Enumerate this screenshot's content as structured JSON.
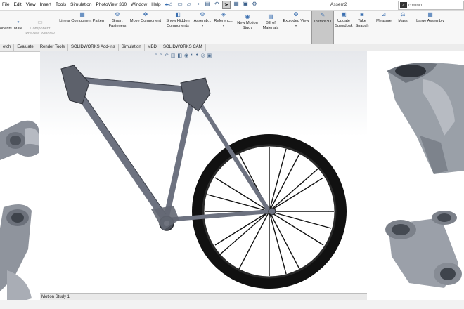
{
  "menu": [
    "File",
    "Edit",
    "View",
    "Insert",
    "Tools",
    "Simulation",
    "PhotoView 360",
    "Window",
    "Help"
  ],
  "document_title": "Assem2",
  "search": {
    "value": "combin"
  },
  "ribbon": {
    "components": "onents",
    "mate": "Mate",
    "component_preview": "Component\nPreview Window",
    "linear_pattern": "Linear Component Pattern",
    "smart_fasteners": "Smart\nFasteners",
    "move_component": "Move Component",
    "show_hidden": "Show Hidden\nComponents",
    "assembly": "Assemb...",
    "reference": "Referenc...",
    "new_motion_study": "New Motion\nStudy",
    "bill_of_materials": "Bill of\nMaterials",
    "exploded_view": "Exploded View",
    "instant3d": "Instant3D",
    "update_speedpak": "Update\nSpeedpak",
    "take_snapshot": "Take\nSnapsh",
    "measure": "Measure",
    "mass": "Mass",
    "large_assembly": "Large Assembly"
  },
  "tabs": [
    "etch",
    "Evaluate",
    "Render Tools",
    "SOLIDWORKS Add-Ins",
    "Simulation",
    "MBD",
    "SOLIDWORKS CAM"
  ],
  "motion_study_tab": "Motion Study 1"
}
